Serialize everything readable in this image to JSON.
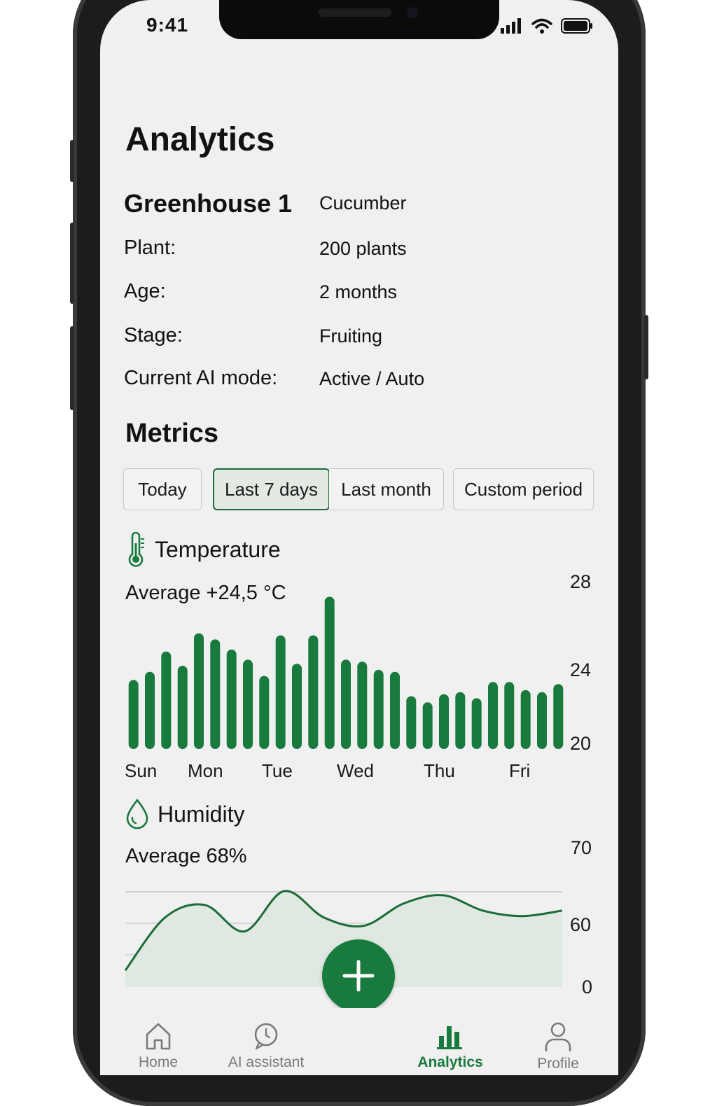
{
  "colors": {
    "accent": "#187a3c",
    "bar": "#187a3c",
    "line": "#1a6b38",
    "area": "#dfe8e1"
  },
  "status_bar": {
    "time": "9:41",
    "icons": [
      "signal-icon",
      "wifi-icon",
      "battery-icon"
    ]
  },
  "page": {
    "title": "Analytics"
  },
  "greenhouse": {
    "name": "Greenhouse 1",
    "crop": "Cucumber",
    "rows": [
      {
        "label": "Plant:",
        "value": "200 plants"
      },
      {
        "label": "Age:",
        "value": "2 months"
      },
      {
        "label": "Stage:",
        "value": "Fruiting"
      },
      {
        "label": "Current AI mode:",
        "value": "Active / Auto"
      }
    ]
  },
  "metrics": {
    "title": "Metrics",
    "periods": [
      "Today",
      "Last 7 days",
      "Last month",
      "Custom period"
    ],
    "selected_period": "Last 7 days"
  },
  "temperature": {
    "title": "Temperature",
    "icon": "thermometer-icon",
    "average": "Average +24,5 °C",
    "axis_labels": [
      "28",
      "24",
      "20"
    ],
    "day_labels": [
      "Sun",
      "Mon",
      "Tue",
      "Wed",
      "Thu",
      "Fri"
    ]
  },
  "humidity": {
    "title": "Humidity",
    "icon": "droplet-icon",
    "average": "Average 68%",
    "axis_labels": [
      "70",
      "60",
      "0"
    ]
  },
  "fab": {
    "icon": "plus-icon"
  },
  "tabbar": {
    "items": [
      {
        "label": "Home",
        "icon": "home-icon"
      },
      {
        "label": "AI assistant",
        "icon": "ai-assistant-icon"
      },
      {
        "label": "Analytics",
        "icon": "analytics-icon"
      },
      {
        "label": "Profile",
        "icon": "profile-icon"
      }
    ],
    "active": "Analytics"
  },
  "chart_data": [
    {
      "type": "bar",
      "title": "Temperature",
      "ylim": [
        20,
        28
      ],
      "yticks": [
        20,
        24,
        28
      ],
      "grid": false,
      "x_tick_labels": [
        "Sun",
        "Mon",
        "Tue",
        "Wed",
        "Thu",
        "Fri"
      ],
      "values": [
        23.4,
        23.8,
        24.8,
        24.1,
        25.7,
        25.4,
        24.9,
        24.4,
        23.6,
        25.6,
        24.2,
        25.6,
        27.5,
        24.4,
        24.3,
        23.9,
        23.8,
        22.6,
        22.3,
        22.7,
        22.8,
        22.5,
        23.3,
        23.3,
        22.9,
        22.8,
        23.2
      ]
    },
    {
      "type": "area",
      "title": "Humidity",
      "ylim": [
        0,
        70
      ],
      "yticks": [
        0,
        60,
        70
      ],
      "grid": true,
      "values": [
        12,
        50,
        59,
        40,
        69,
        50,
        44,
        60,
        66,
        55,
        51,
        55
      ]
    }
  ]
}
